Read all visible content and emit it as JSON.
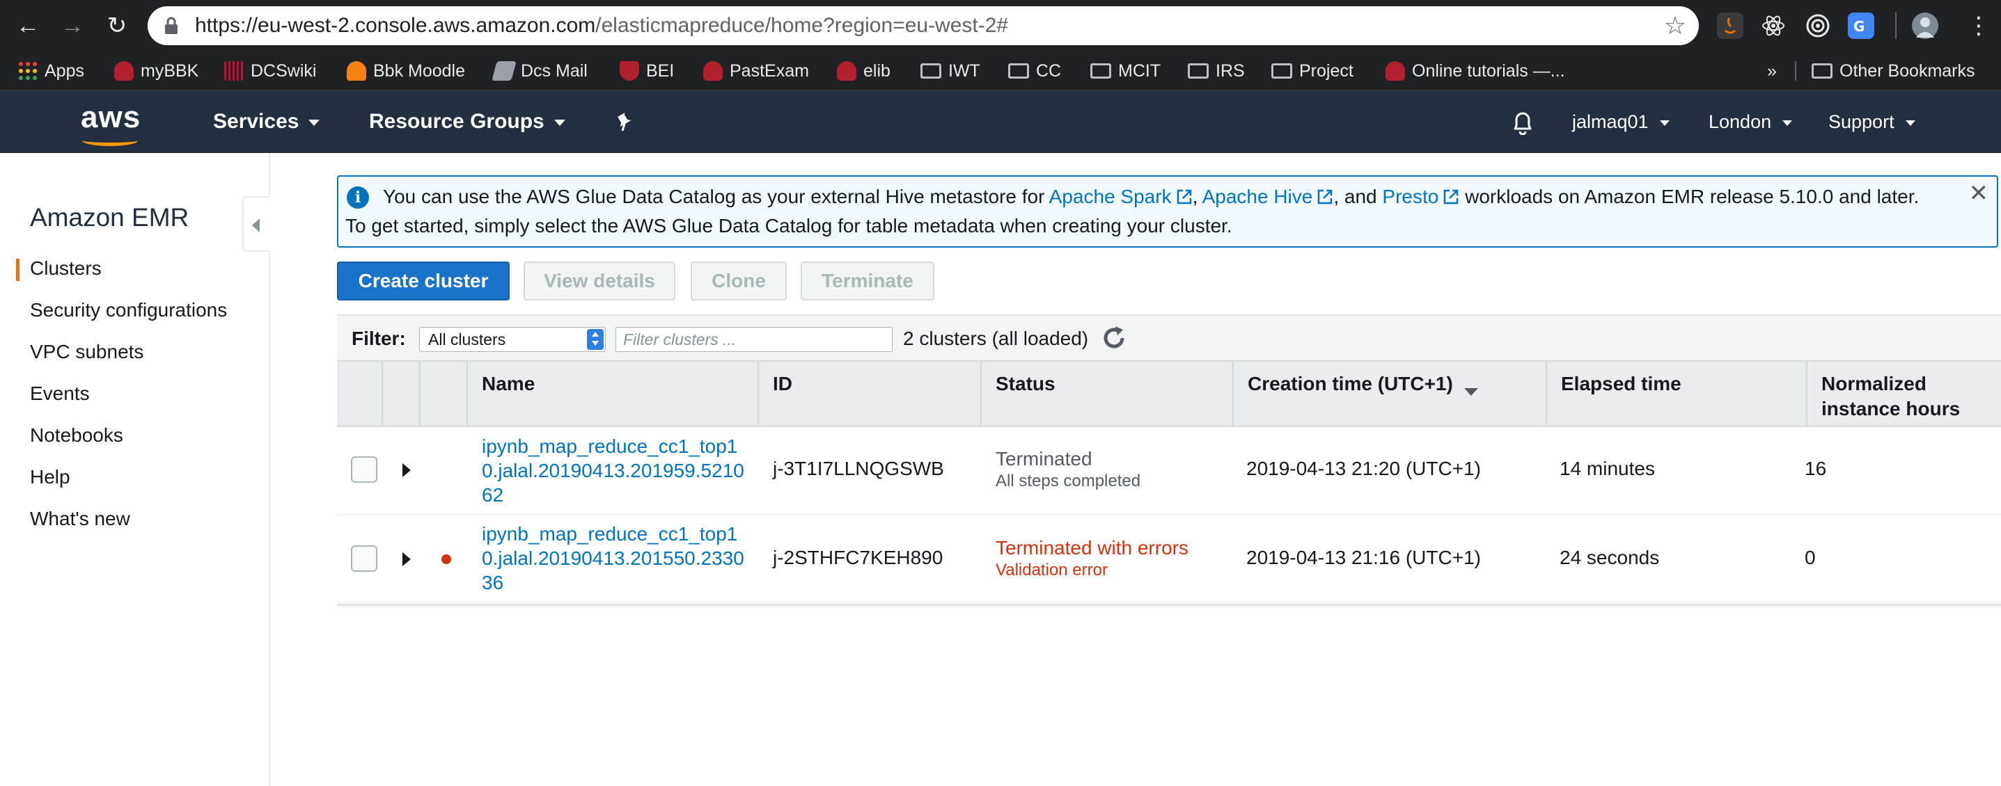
{
  "browser": {
    "url_host": "https://eu-west-2.console.aws.amazon.com",
    "url_path": "/elasticmapreduce/home?region=eu-west-2#",
    "bookmarks": [
      {
        "label": "Apps",
        "icon": "apps-grid-icon"
      },
      {
        "label": "myBBK",
        "icon": "bbk-owl-icon"
      },
      {
        "label": "DCSwiki",
        "icon": "dcs-icon"
      },
      {
        "label": "Bbk Moodle",
        "icon": "moodle-icon"
      },
      {
        "label": "Dcs Mail",
        "icon": "mail-icon"
      },
      {
        "label": "BEI",
        "icon": "bei-shield-icon"
      },
      {
        "label": "PastExam",
        "icon": "bbk-owl-icon"
      },
      {
        "label": "elib",
        "icon": "bbk-owl-icon"
      },
      {
        "label": "IWT",
        "icon": "folder-icon"
      },
      {
        "label": "CC",
        "icon": "folder-icon"
      },
      {
        "label": "MCIT",
        "icon": "folder-icon"
      },
      {
        "label": "IRS",
        "icon": "folder-icon"
      },
      {
        "label": "Project",
        "icon": "folder-icon"
      },
      {
        "label": "Online tutorials —...",
        "icon": "bbk-owl-icon"
      }
    ],
    "overflow_label": "»",
    "other_bookmarks": "Other Bookmarks"
  },
  "aws_header": {
    "logo": "aws",
    "services": "Services",
    "resource_groups": "Resource Groups",
    "user": "jalmaq01",
    "region": "London",
    "support": "Support"
  },
  "sidebar": {
    "title": "Amazon EMR",
    "items": [
      {
        "label": "Clusters",
        "active": true
      },
      {
        "label": "Security configurations"
      },
      {
        "label": "VPC subnets"
      },
      {
        "label": "Events"
      },
      {
        "label": "Notebooks"
      },
      {
        "label": "Help"
      },
      {
        "label": "What's new"
      }
    ]
  },
  "banner": {
    "text_before": "You can use the AWS Glue Data Catalog as your external Hive metastore for ",
    "link1": "Apache Spark",
    "sep1": ", ",
    "link2": "Apache Hive",
    "sep2": ", and ",
    "link3": "Presto",
    "text_after": " workloads on Amazon EMR release 5.10.0 and later.",
    "line2": "To get started, simply select the AWS Glue Data Catalog for table metadata when creating your cluster.",
    "close": "✕"
  },
  "toolbar": {
    "create": "Create cluster",
    "view_details": "View details",
    "clone": "Clone",
    "terminate": "Terminate"
  },
  "filter": {
    "label": "Filter:",
    "selected": "All clusters",
    "placeholder": "Filter clusters ...",
    "count": "2 clusters (all loaded)"
  },
  "table": {
    "headers": {
      "name": "Name",
      "id": "ID",
      "status": "Status",
      "creation_time": "Creation time (UTC+1)",
      "elapsed": "Elapsed time",
      "normalized_1": "Normalized",
      "normalized_2": "instance hours"
    },
    "rows": [
      {
        "name": "ipynb_map_reduce_cc1_top10.jalal.20190413.201959.521062",
        "id": "j-3T1I7LLNQGSWB",
        "status": "Terminated",
        "status_detail": "All steps completed",
        "creation_time": "2019-04-13 21:20 (UTC+1)",
        "elapsed": "14 minutes",
        "normalized_hours": "16"
      },
      {
        "name": "ipynb_map_reduce_cc1_top10.jalal.20190413.201550.233036",
        "id": "j-2STHFC7KEH890",
        "status": "Terminated with errors",
        "status_detail": "Validation error",
        "creation_time": "2019-04-13 21:16 (UTC+1)",
        "elapsed": "24 seconds",
        "normalized_hours": "0"
      }
    ]
  },
  "colors": {
    "aws_header_bg": "#232f3e",
    "aws_orange": "#ff9900",
    "primary_button": "#1a73c8",
    "link": "#0073bb",
    "error": "#d13212"
  }
}
